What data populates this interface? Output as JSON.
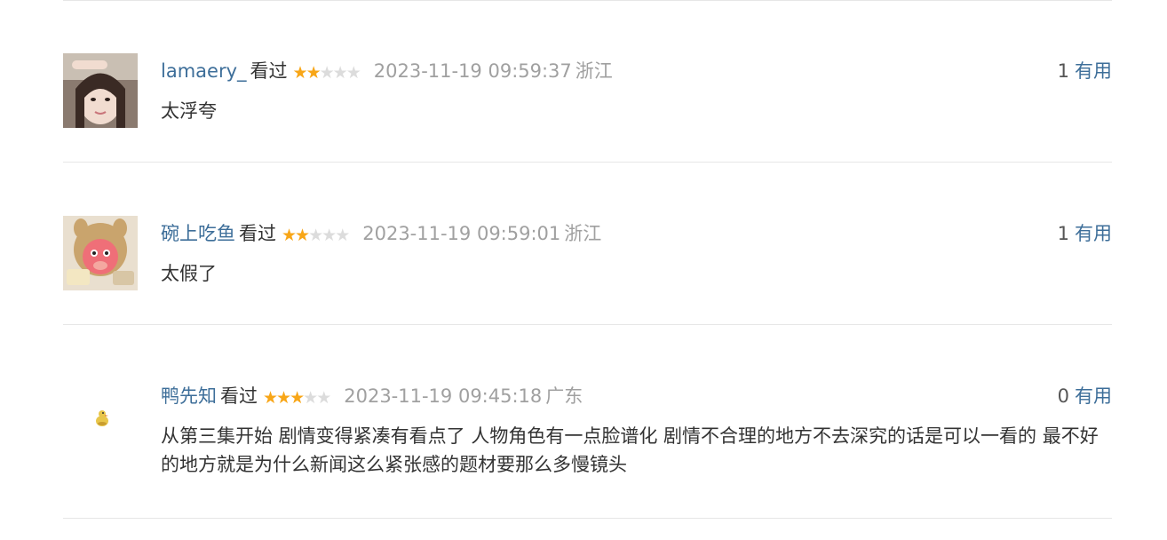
{
  "comments": [
    {
      "username": "lamaery_",
      "status": "看过",
      "rating": 2,
      "max_rating": 5,
      "time": "2023-11-19 09:59:37",
      "location": "浙江",
      "votes": "1",
      "useful_label": "有用",
      "text": "太浮夸",
      "avatar": "user-photo-avatar"
    },
    {
      "username": "碗上吃鱼",
      "status": "看过",
      "rating": 2,
      "max_rating": 5,
      "time": "2023-11-19 09:59:01",
      "location": "浙江",
      "votes": "1",
      "useful_label": "有用",
      "text": "太假了",
      "avatar": "plush-toy-avatar"
    },
    {
      "username": "鸭先知",
      "status": "看过",
      "rating": 3,
      "max_rating": 5,
      "time": "2023-11-19 09:45:18",
      "location": "广东",
      "votes": "0",
      "useful_label": "有用",
      "text": "从第三集开始 剧情变得紧凑有看点了 人物角色有一点脸谱化 剧情不合理的地方不去深究的话是可以一看的 最不好的地方就是为什么新闻这么紧张感的题材要那么多慢镜头",
      "avatar": "duck-avatar"
    }
  ],
  "colors": {
    "link": "#3d6e99",
    "star_on": "#f8a617",
    "star_off": "#dcdcdc",
    "meta_gray": "#a0a0a0"
  }
}
